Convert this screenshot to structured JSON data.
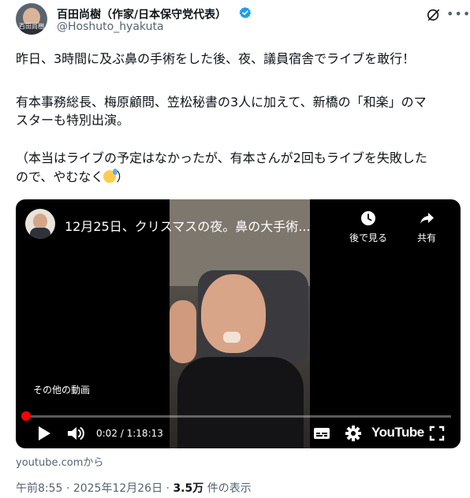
{
  "author": {
    "name": "百田尚樹（作家/日本保守党代表）",
    "handle": "@Hoshuto_hyakuta",
    "avatar_signature": "百田尚樹"
  },
  "tweet": {
    "lines": [
      "昨日、3時間に及ぶ鼻の手術をした後、夜、議員宿舎でライブを敢行！",
      "",
      "有本事務総長、梅原顧問、笠松秘書の3人に加えて、新橋の「和楽」のマ",
      "スターも特別出演。",
      "",
      "（本当はライブの予定はなかったが、有本さんが2回もライブを失敗した",
      "ので、やむなく"
    ],
    "closing_paren": "）",
    "emoji": "sweat-smile-emoji"
  },
  "video": {
    "title": "12月25日、クリスマスの夜。鼻の大手術...",
    "watch_later": "後で見る",
    "share": "共有",
    "more_videos": "その他の動画",
    "time": "0:02 / 1:18:13",
    "progress": 0.0004,
    "youtube_logo": "YouTube"
  },
  "source": "youtube.comから",
  "meta": {
    "time": "午前8:55",
    "sep1": " · ",
    "date": "2025年12月26日",
    "sep2": " · ",
    "views": "3.5万",
    "views_suffix": " 件の表示"
  },
  "colors": {
    "verified": "#1d9bf0",
    "progress": "#ff0000",
    "muted_text": "#536471"
  }
}
